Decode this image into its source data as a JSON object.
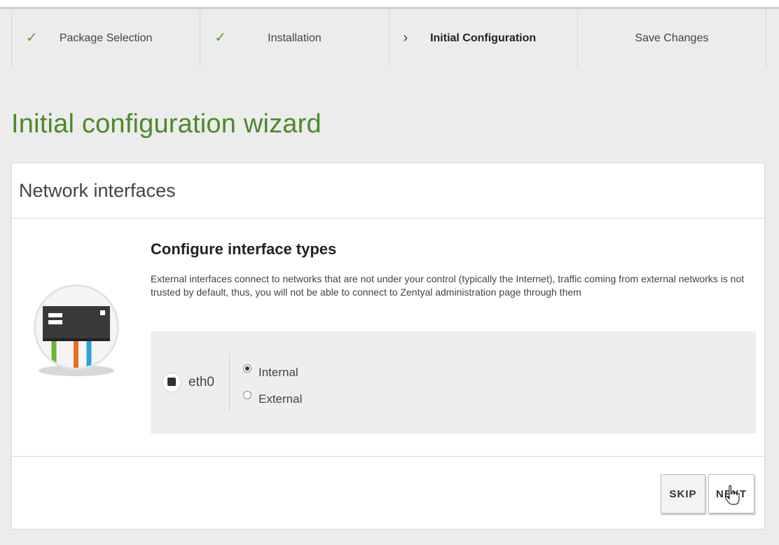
{
  "steps": [
    {
      "label": "Package Selection",
      "state": "done",
      "mark": "✓"
    },
    {
      "label": "Installation",
      "state": "done",
      "mark": "✓"
    },
    {
      "label": "Initial Configuration",
      "state": "current",
      "mark": "›"
    },
    {
      "label": "Save Changes",
      "state": "pending",
      "mark": ""
    }
  ],
  "page_title": "Initial configuration wizard",
  "panel": {
    "title": "Network interfaces",
    "section_title": "Configure interface types",
    "description": "External interfaces connect to networks that are not under your control (typically the Internet), traffic coming from external networks is not trusted by default, thus, you will not be able to connect to Zentyal administration page through them"
  },
  "interface": {
    "name": "eth0",
    "options": [
      {
        "label": "Internal",
        "checked": true
      },
      {
        "label": "External",
        "checked": false
      }
    ]
  },
  "buttons": {
    "skip": "SKIP",
    "next": "NEXT"
  },
  "colors": {
    "accent_green": "#4a8a2a",
    "check_green": "#5aa02c",
    "illus_green": "#6bb536",
    "illus_orange": "#e8701e",
    "illus_blue": "#2aa6d6"
  }
}
